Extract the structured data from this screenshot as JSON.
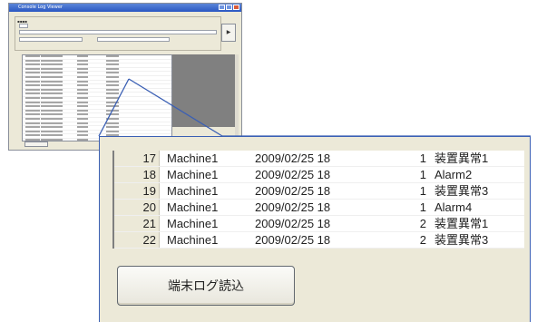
{
  "thumbnail": {
    "title": "Console Log Viewer",
    "go_label": "▶"
  },
  "zoom": {
    "rows": [
      {
        "idx": "17",
        "machine": "Machine1",
        "date": "2009/02/25 18",
        "num": "1",
        "alarm": "装置異常1"
      },
      {
        "idx": "18",
        "machine": "Machine1",
        "date": "2009/02/25 18",
        "num": "1",
        "alarm": "Alarm2"
      },
      {
        "idx": "19",
        "machine": "Machine1",
        "date": "2009/02/25 18",
        "num": "1",
        "alarm": "装置異常3"
      },
      {
        "idx": "20",
        "machine": "Machine1",
        "date": "2009/02/25 18",
        "num": "1",
        "alarm": "Alarm4"
      },
      {
        "idx": "21",
        "machine": "Machine1",
        "date": "2009/02/25 18",
        "num": "2",
        "alarm": "装置異常1"
      },
      {
        "idx": "22",
        "machine": "Machine1",
        "date": "2009/02/25 18",
        "num": "2",
        "alarm": "装置異常3"
      }
    ],
    "button_label": "端末ログ読込"
  }
}
